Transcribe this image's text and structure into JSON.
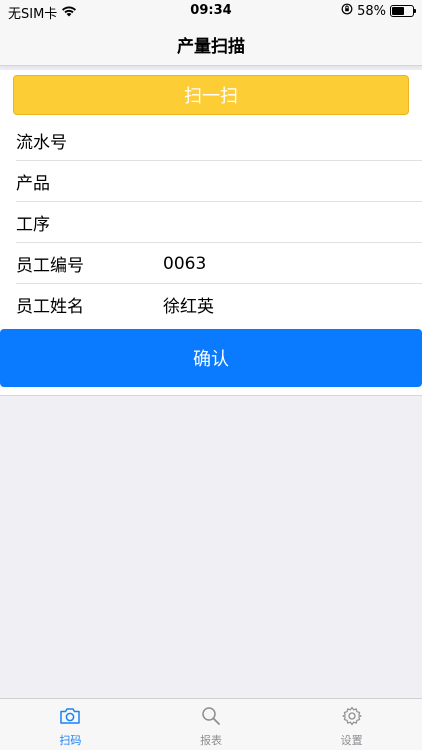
{
  "status_bar": {
    "carrier": "无SIM卡",
    "time": "09:34",
    "battery_percent": "58%",
    "battery_level": 0.58
  },
  "nav": {
    "title": "产量扫描"
  },
  "scan_button": {
    "label": "扫一扫",
    "color": "#fdcd36"
  },
  "form": {
    "rows": [
      {
        "label": "流水号",
        "value": ""
      },
      {
        "label": "产品",
        "value": ""
      },
      {
        "label": "工序",
        "value": ""
      },
      {
        "label": "员工编号",
        "value": "0063"
      },
      {
        "label": "员工姓名",
        "value": "徐红英"
      }
    ]
  },
  "confirm_button": {
    "label": "确认",
    "color": "#0a7aff"
  },
  "tab_bar": {
    "tabs": [
      {
        "label": "扫码",
        "icon": "camera-icon",
        "active": true
      },
      {
        "label": "报表",
        "icon": "search-icon",
        "active": false
      },
      {
        "label": "设置",
        "icon": "gear-icon",
        "active": false
      }
    ],
    "active_color": "#1a82f5"
  }
}
